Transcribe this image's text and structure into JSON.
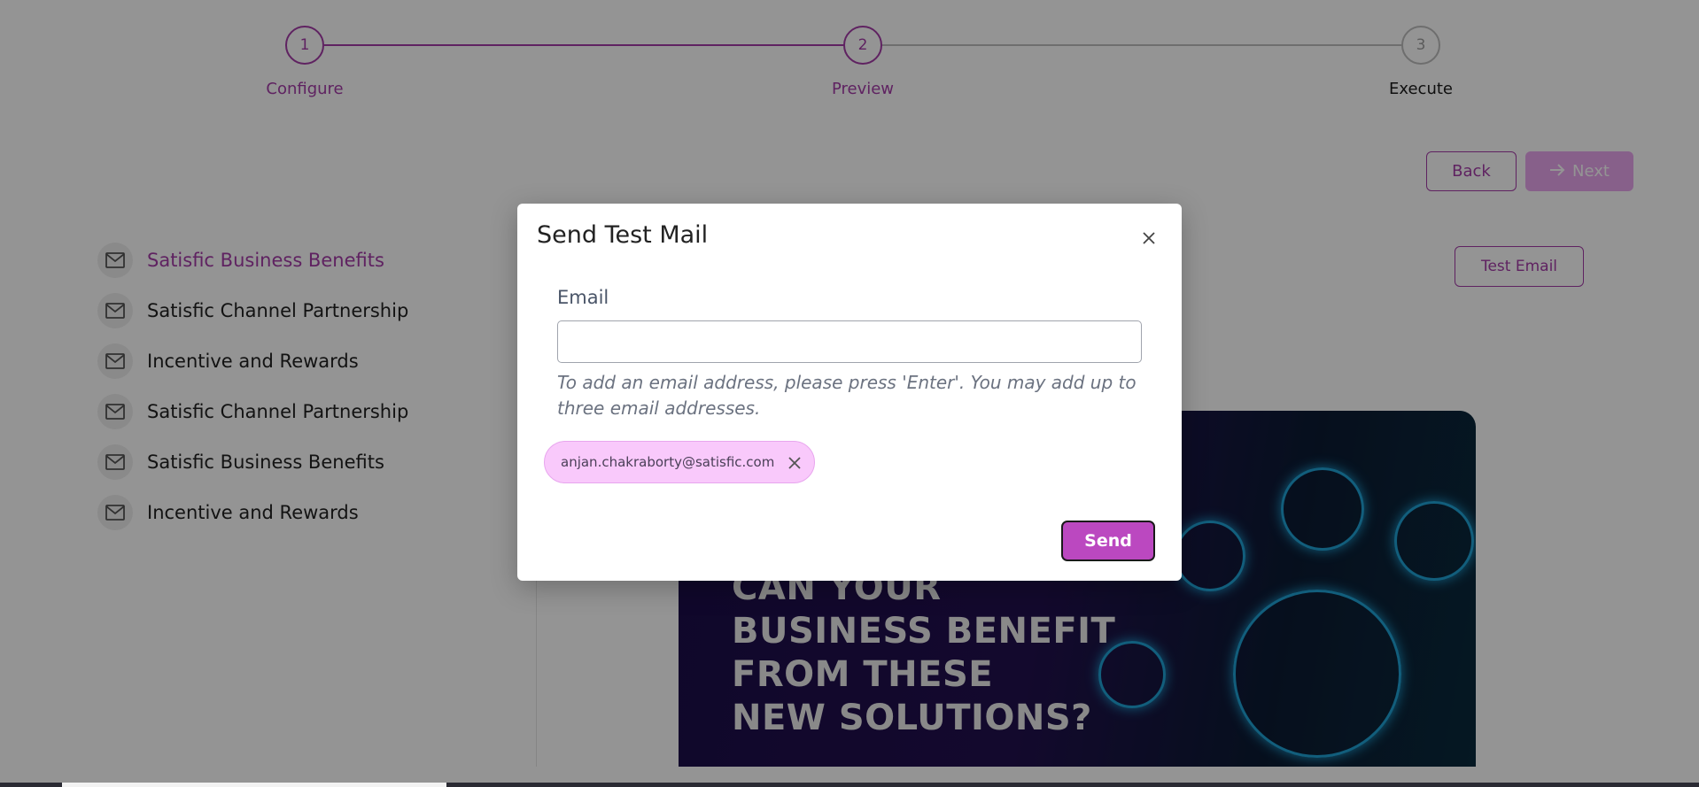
{
  "stepper": {
    "steps": [
      {
        "number": "1",
        "label": "Configure",
        "state": "complete"
      },
      {
        "number": "2",
        "label": "Preview",
        "state": "active"
      },
      {
        "number": "3",
        "label": "Execute",
        "state": "inactive"
      }
    ]
  },
  "toolbar": {
    "back_label": "Back",
    "next_label": "Next",
    "test_email_label": "Test Email"
  },
  "sidebar": {
    "items": [
      {
        "label": "Satisfic Business Benefits",
        "icon": "mail-icon",
        "active": true
      },
      {
        "label": "Satisfic Channel Partnership",
        "icon": "mail-icon"
      },
      {
        "label": "Incentive and Rewards",
        "icon": "mail-icon"
      },
      {
        "label": "Satisfic Channel Partnership",
        "icon": "mail-icon"
      },
      {
        "label": "Satisfic Business Benefits",
        "icon": "mail-icon"
      },
      {
        "label": "Incentive and Rewards",
        "icon": "mail-icon"
      }
    ]
  },
  "preview": {
    "banner_lines": [
      "CAN YOUR",
      "BUSINESS BENEFIT",
      "FROM THESE",
      "NEW SOLUTIONS?"
    ]
  },
  "modal": {
    "title": "Send Test Mail",
    "email_label": "Email",
    "email_value": "",
    "hint": "To add an email address, please press 'Enter'. You may add up to three email addresses.",
    "chips": [
      "anjan.chakraborty@satisfic.com"
    ],
    "send_label": "Send"
  },
  "colors": {
    "accent": "#a43ca8",
    "send_button": "#bb48c0",
    "chip_bg": "#f9c9fb",
    "next_disabled": "#e8a6ee"
  }
}
